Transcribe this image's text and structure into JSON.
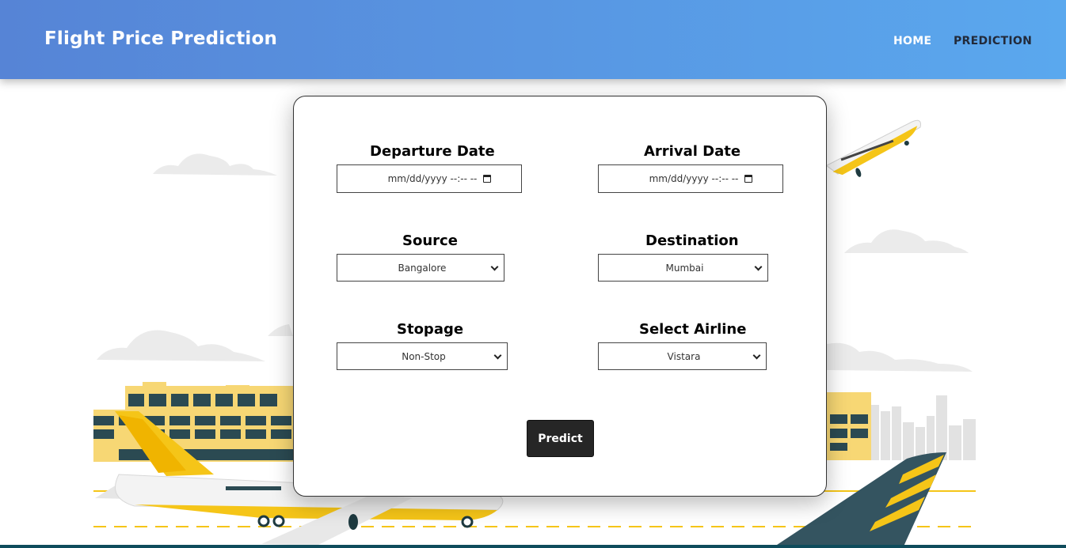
{
  "navbar": {
    "brand": "Flight Price Prediction",
    "links": [
      {
        "label": "HOME"
      },
      {
        "label": "PREDICTION"
      }
    ]
  },
  "form": {
    "departure": {
      "label": "Departure Date",
      "value": "mm/dd/yyyy --:-- --"
    },
    "arrival": {
      "label": "Arrival Date",
      "value": "mm/dd/yyyy --:-- --"
    },
    "source": {
      "label": "Source",
      "value": "Bangalore"
    },
    "destination": {
      "label": "Destination",
      "value": "Mumbai"
    },
    "stopage": {
      "label": "Stopage",
      "value": "Non-Stop"
    },
    "airline": {
      "label": "Select Airline",
      "value": "Vistara"
    },
    "submit_label": "Predict"
  },
  "colors": {
    "navbar_start": "#5684d6",
    "navbar_end": "#5aa8ee",
    "button": "#262626",
    "plane_yellow": "#f5c518",
    "tail_teal": "#345460"
  },
  "icons": [
    "calendar-icon",
    "chevron-down-icon"
  ]
}
